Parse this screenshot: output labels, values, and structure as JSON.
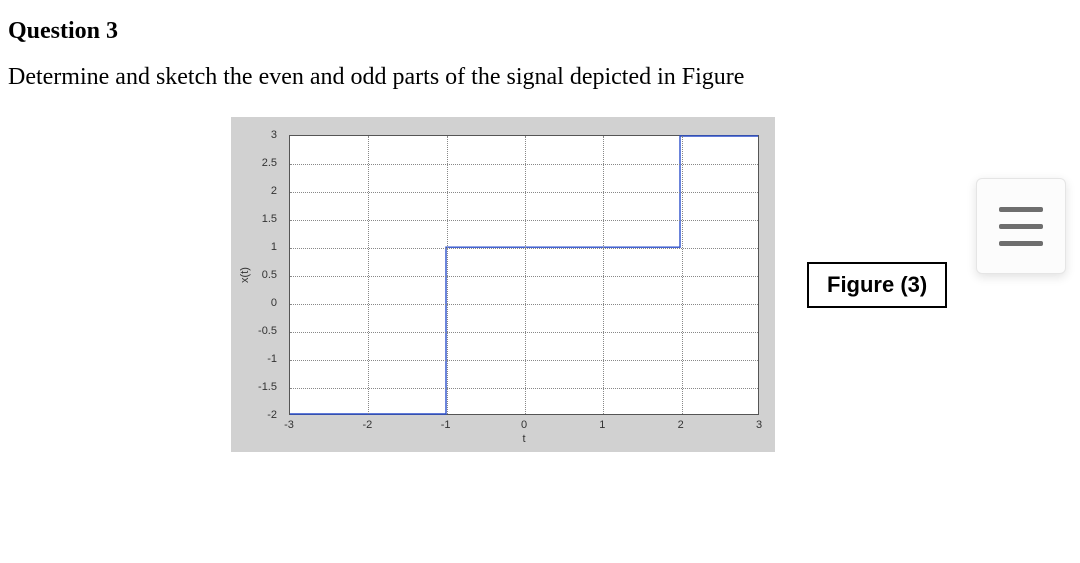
{
  "question": {
    "heading": "Question 3",
    "prompt": "Determine and sketch the even and odd parts of the signal depicted in Figure"
  },
  "figure_caption": "Figure (3)",
  "menu_icon_name": "hamburger-menu-icon",
  "chart_data": {
    "type": "line",
    "title": "",
    "xlabel": "t",
    "ylabel": "x(t)",
    "xlim": [
      -3,
      3
    ],
    "ylim": [
      -2,
      3
    ],
    "xticks": [
      -3,
      -2,
      -1,
      0,
      1,
      2,
      3
    ],
    "yticks": [
      -2,
      -1.5,
      -1,
      -0.5,
      0,
      0.5,
      1,
      1.5,
      2,
      2.5,
      3
    ],
    "series": [
      {
        "name": "x(t)",
        "x": [
          -3,
          -1,
          -1,
          2,
          2,
          3
        ],
        "y": [
          -2,
          -2,
          1,
          1,
          3,
          3
        ]
      }
    ]
  }
}
